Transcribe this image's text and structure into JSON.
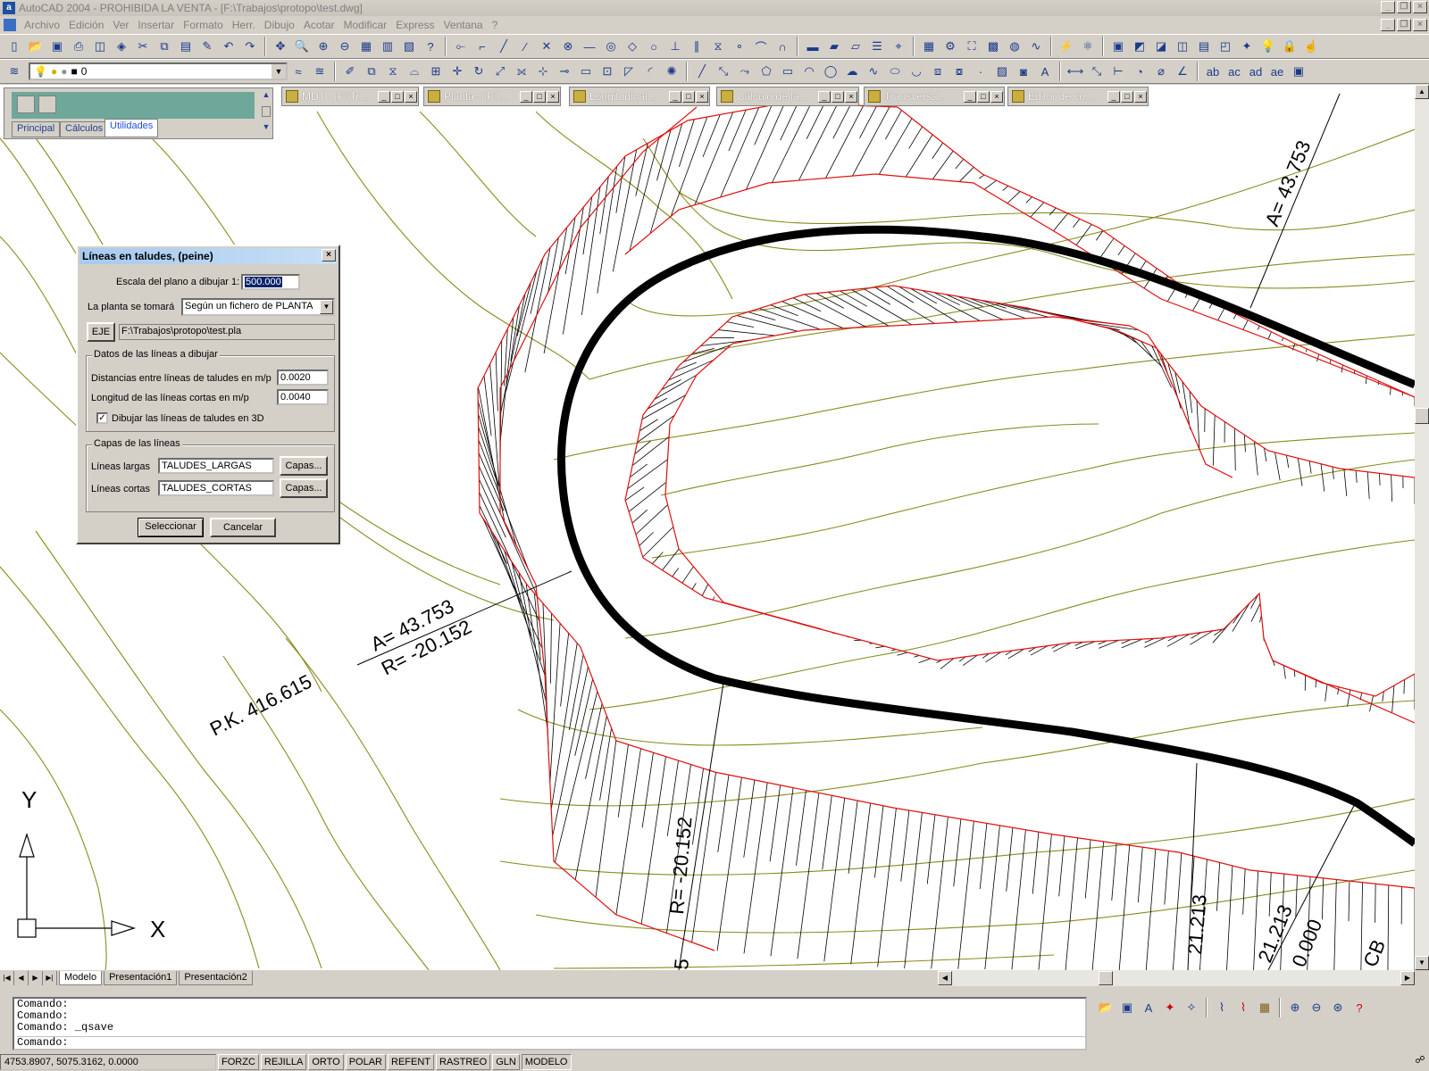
{
  "window": {
    "title": "AutoCAD 2004 - PROHIBIDA LA VENTA - [F:\\Trabajos\\protopo\\test.dwg]"
  },
  "menu": [
    "Archivo",
    "Edición",
    "Ver",
    "Insertar",
    "Formato",
    "Herr.",
    "Dibujo",
    "Acotar",
    "Modificar",
    "Express",
    "Ventana",
    "?"
  ],
  "layer": {
    "current": "0"
  },
  "minipanel": {
    "tabs": [
      "Principal",
      "Cálculos",
      "Utilidades"
    ],
    "active_tab": "Utilidades"
  },
  "doc_tabs": [
    "MDT - [F:\\Tr...",
    "Planta - [F:\\...",
    "Longitudinal...",
    "Cálculo de la...",
    "Transversal...",
    "Editor de co..."
  ],
  "dialog": {
    "title": "Líneas en taludes, (peine)",
    "scale_label": "Escala del plano a dibujar 1:",
    "scale_value": "500.000",
    "plan_label": "La planta se tomará",
    "plan_value": "Según un fichero de PLANTA",
    "eje_button": "EJE",
    "eje_path": "F:\\Trabajos\\protopo\\test.pla",
    "group_data_title": "Datos de las líneas a dibujar",
    "dist_label": "Distancias entre líneas de taludes en m/p",
    "dist_value": "0.0020",
    "short_len_label": "Longitud de las líneas cortas en m/p",
    "short_len_value": "0.0040",
    "draw3d_label": "Dibujar las líneas de taludes en 3D",
    "draw3d_checked": true,
    "group_layers_title": "Capas de las líneas",
    "long_label": "Líneas largas",
    "long_value": "TALUDES_LARGAS",
    "short_label": "Líneas cortas",
    "short_value": "TALUDES_CORTAS",
    "layers_button": "Capas...",
    "select_button": "Seleccionar",
    "cancel_button": "Cancelar"
  },
  "drawing": {
    "annotations": {
      "pk": "P.K. 416.615",
      "a_left": "A= 43.753",
      "r_left": "R= -20.152",
      "a_top": "A= 43.753",
      "r_vertical": "R= -20.152",
      "val_right1": "21.213",
      "val_right2": "21.213",
      "val_right3": "0.000",
      "val_right4": "CB",
      "partial_5": "5"
    },
    "ucs": {
      "x_label": "X",
      "y_label": "Y"
    },
    "colors": {
      "contours": "#8a8a1c",
      "slope_edges": "#e01010",
      "axis": "#000000",
      "hatch": "#000000"
    }
  },
  "layout_tabs": [
    "Modelo",
    "Presentación1",
    "Presentación2"
  ],
  "active_layout": "Modelo",
  "command_lines": [
    "Comando:",
    "Comando:",
    "Comando: _qsave"
  ],
  "command_prompt": "Comando:",
  "status": {
    "coords": "4753.8907, 5075.3162, 0.0000",
    "buttons": [
      "FORZC",
      "REJILLA",
      "ORTO",
      "POLAR",
      "REFENT",
      "RASTREO",
      "GLN",
      "MODELO"
    ],
    "active": [
      "MODELO"
    ]
  }
}
